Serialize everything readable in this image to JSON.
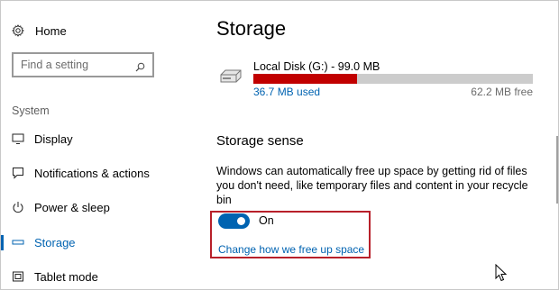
{
  "sidebar": {
    "home_label": "Home",
    "search_placeholder": "Find a setting",
    "section_label": "System",
    "items": [
      {
        "label": "Display",
        "icon": "monitor-icon"
      },
      {
        "label": "Notifications & actions",
        "icon": "notifications-icon"
      },
      {
        "label": "Power & sleep",
        "icon": "power-icon"
      },
      {
        "label": "Storage",
        "icon": "storage-icon",
        "active": true
      },
      {
        "label": "Tablet mode",
        "icon": "tablet-icon"
      }
    ]
  },
  "main": {
    "title": "Storage",
    "disk": {
      "name": "Local Disk (G:) - 99.0 MB",
      "used_label": "36.7 MB used",
      "free_label": "62.2 MB free",
      "used_fraction": 0.37
    },
    "storage_sense": {
      "title": "Storage sense",
      "description": "Windows can automatically free up space by getting rid of files you don't need, like temporary files and content in your recycle bin",
      "toggle_state": "On",
      "link_label": "Change how we free up space"
    }
  },
  "colors": {
    "accent": "#0063b1",
    "bar_used": "#c10000",
    "bar_free": "#cccccc",
    "highlight_border": "#b8202a"
  }
}
